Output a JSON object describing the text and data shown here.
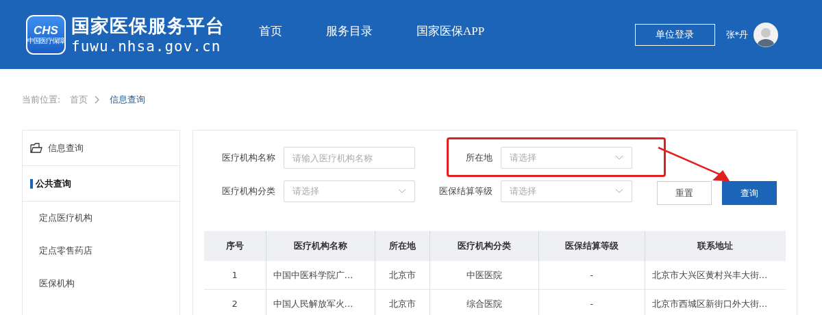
{
  "header": {
    "logo_mark": "CHS",
    "logo_subtitle": "中国医疗保障",
    "site_title": "国家医保服务平台",
    "site_url": "fuwu.nhsa.gov.cn",
    "nav": [
      {
        "label": "首页",
        "selected": false
      },
      {
        "label": "服务目录",
        "selected": false
      },
      {
        "label": "国家医保APP",
        "selected": false
      }
    ],
    "login_button": "单位登录",
    "user_name": "张*丹"
  },
  "breadcrumb": {
    "label": "当前位置:",
    "items": [
      "首页",
      "信息查询"
    ]
  },
  "sidebar": {
    "items": [
      {
        "kind": "folder",
        "label": "信息查询",
        "selected": false
      },
      {
        "kind": "section",
        "label": "公共查询",
        "selected": true
      },
      {
        "kind": "link",
        "label": "定点医疗机构",
        "selected": false
      },
      {
        "kind": "link",
        "label": "定点零售药店",
        "selected": false
      },
      {
        "kind": "link",
        "label": "医保机构",
        "selected": false
      }
    ]
  },
  "filters": [
    {
      "kind": "text",
      "label": "医疗机构名称",
      "placeholder": "请输入医疗机构名称",
      "highlighted": false
    },
    {
      "kind": "select",
      "label": "所在地",
      "placeholder": "请选择",
      "highlighted": true
    },
    {
      "kind": "select",
      "label": "医疗机构分类",
      "placeholder": "请选择",
      "highlighted": false
    },
    {
      "kind": "select",
      "label": "医保结算等级",
      "placeholder": "请选择",
      "highlighted": false
    }
  ],
  "buttons": {
    "reset": "重置",
    "search": "查询"
  },
  "table": {
    "columns": [
      "序号",
      "医疗机构名称",
      "所在地",
      "医疗机构分类",
      "医保结算等级",
      "联系地址"
    ],
    "rows": [
      [
        "1",
        "中国中医科学院广…",
        "北京市",
        "中医医院",
        "-",
        "北京市大兴区黄村兴丰大街…"
      ],
      [
        "2",
        "中国人民解放军火…",
        "北京市",
        "综合医院",
        "-",
        "北京市西城区新街口外大街…"
      ]
    ]
  }
}
